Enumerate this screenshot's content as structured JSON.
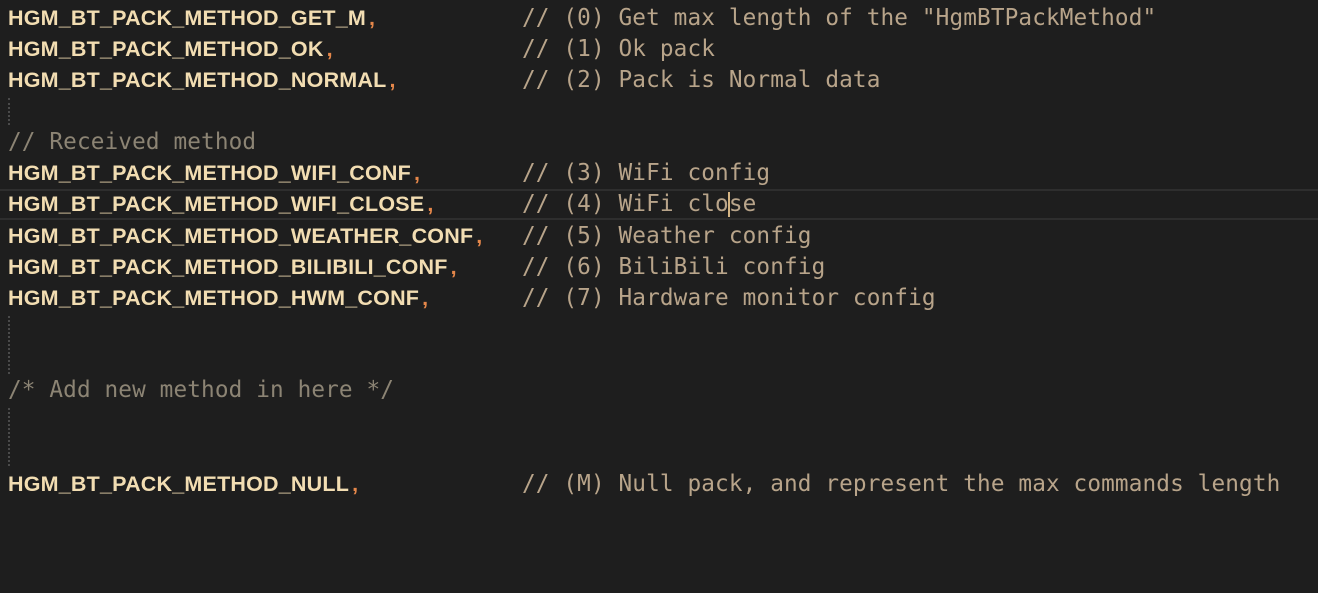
{
  "editor": {
    "lines": [
      {
        "ident": "HGM_BT_PACK_METHOD_GET_M",
        "comma": ",",
        "comment": "// (0) Get max length of the \"HgmBTPackMethod\""
      },
      {
        "ident": "HGM_BT_PACK_METHOD_OK",
        "comma": ",",
        "comment": "// (1) Ok pack"
      },
      {
        "ident": "HGM_BT_PACK_METHOD_NORMAL",
        "comma": ",",
        "comment": "// (2) Pack is Normal data"
      },
      {
        "comment_only": "// Received method"
      },
      {
        "ident": "HGM_BT_PACK_METHOD_WIFI_CONF",
        "comma": ",",
        "comment": "// (3) WiFi config"
      },
      {
        "ident": "HGM_BT_PACK_METHOD_WIFI_CLOSE",
        "comma": ",",
        "comment_before_cursor": "// (4) WiFi clo",
        "comment_after_cursor": "se"
      },
      {
        "ident": "HGM_BT_PACK_METHOD_WEATHER_CONF",
        "comma": ",",
        "comment": "// (5) Weather config"
      },
      {
        "ident": "HGM_BT_PACK_METHOD_BILIBILI_CONF",
        "comma": ",",
        "comment": "// (6) BiliBili config"
      },
      {
        "ident": "HGM_BT_PACK_METHOD_HWM_CONF",
        "comma": ",",
        "comment": "// (7) Hardware monitor config"
      },
      {
        "comment_only": "/* Add new method in here */"
      },
      {
        "ident": "HGM_BT_PACK_METHOD_NULL",
        "comma": ",",
        "comment": "// (M) Null pack, and represent the max commands length"
      }
    ]
  },
  "colors": {
    "background": "#1e1e1e",
    "identifier": "#f2ddb2",
    "punctuation": "#e5874a",
    "comment": "#b8a48a",
    "cursor": "#d4b483"
  }
}
